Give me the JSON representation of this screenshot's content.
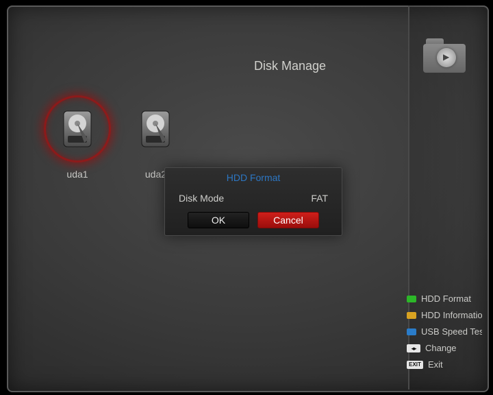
{
  "header": {
    "title": "Disk Manage"
  },
  "disks": [
    {
      "label": "uda1",
      "selected": true
    },
    {
      "label": "uda2",
      "selected": false
    }
  ],
  "dialog": {
    "title": "HDD Format",
    "row_label": "Disk Mode",
    "row_value": "FAT",
    "ok_label": "OK",
    "cancel_label": "Cancel"
  },
  "legend": {
    "format": "HDD Format",
    "info": "HDD Informatio",
    "usb": "USB Speed Tes",
    "change": "Change",
    "exit": "Exit"
  }
}
